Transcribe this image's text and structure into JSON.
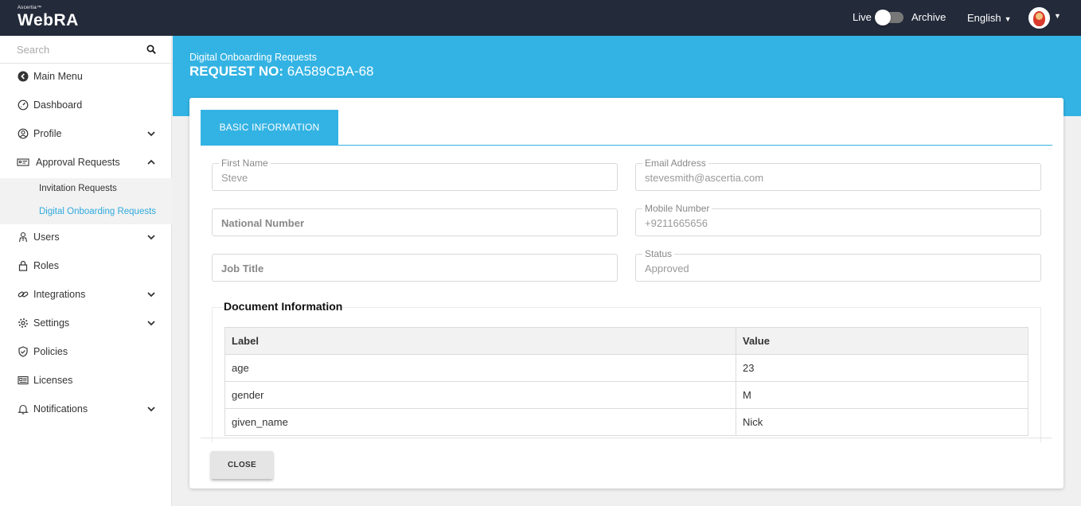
{
  "header": {
    "brand_small": "Ascertia™",
    "brand": "WebRA",
    "live_label": "Live",
    "archive_label": "Archive",
    "language": "English"
  },
  "sidebar": {
    "search_placeholder": "Search",
    "items": [
      {
        "label": "Main Menu",
        "icon": "back-arrow-icon"
      },
      {
        "label": "Dashboard",
        "icon": "dashboard-gauge-icon"
      },
      {
        "label": "Profile",
        "icon": "user-circle-icon"
      },
      {
        "label": "Approval Requests",
        "icon": "id-card-icon"
      },
      {
        "label": "Users",
        "icon": "users-icon"
      },
      {
        "label": "Roles",
        "icon": "lock-icon"
      },
      {
        "label": "Integrations",
        "icon": "link-icon"
      },
      {
        "label": "Settings",
        "icon": "gear-icon"
      },
      {
        "label": "Policies",
        "icon": "shield-check-icon"
      },
      {
        "label": "Licenses",
        "icon": "license-icon"
      },
      {
        "label": "Notifications",
        "icon": "bell-icon"
      }
    ],
    "submenu": [
      {
        "label": "Invitation Requests"
      },
      {
        "label": "Digital Onboarding Requests",
        "active": true
      }
    ]
  },
  "page": {
    "breadcrumb": "Digital Onboarding Requests",
    "request_prefix": "REQUEST NO:",
    "request_no": "6A589CBA-68",
    "tab_label": "BASIC INFORMATION"
  },
  "form": {
    "first_name": {
      "label": "First Name",
      "value": "Steve"
    },
    "email": {
      "label": "Email Address",
      "value": "stevesmith@ascertia.com"
    },
    "national_number": {
      "label": "National Number"
    },
    "mobile": {
      "label": "Mobile Number",
      "value": "+9211665656"
    },
    "job_title": {
      "label": "Job Title"
    },
    "status": {
      "label": "Status",
      "value": "Approved"
    }
  },
  "document": {
    "title": "Document Information",
    "columns": [
      "Label",
      "Value"
    ],
    "rows": [
      [
        "age",
        "23"
      ],
      [
        "gender",
        "M"
      ],
      [
        "given_name",
        "Nick"
      ]
    ]
  },
  "footer": {
    "close_label": "CLOSE"
  },
  "colors": {
    "topbar": "#232a3a",
    "accent": "#33b3e3"
  }
}
